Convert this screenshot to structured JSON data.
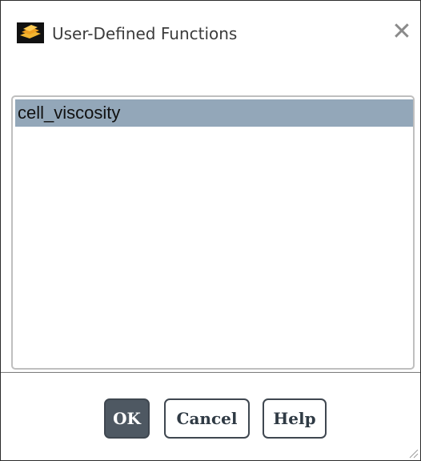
{
  "window": {
    "title": "User-Defined Functions",
    "app_icon": "ansys-fluent-icon",
    "close_icon": "close-icon"
  },
  "list": {
    "items": [
      {
        "label": "cell_viscosity",
        "selected": true
      }
    ],
    "selected_color": "#93a7b9"
  },
  "buttons": {
    "ok_label": "OK",
    "cancel_label": "Cancel",
    "help_label": "Help"
  },
  "colors": {
    "primary_button": "#4e5862",
    "button_border": "#3f4750"
  }
}
